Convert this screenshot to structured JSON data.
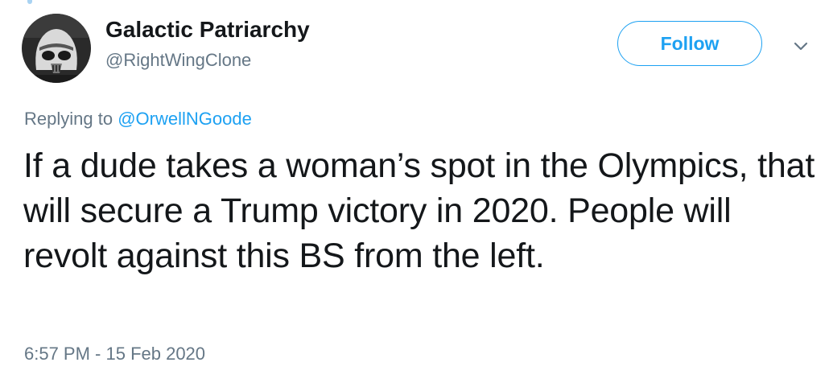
{
  "user": {
    "display_name": "Galactic Patriarchy",
    "handle": "@RightWingClone",
    "avatar_icon": "stormtrooper-helmet-avatar"
  },
  "actions": {
    "follow_label": "Follow",
    "more_icon": "chevron-down-icon"
  },
  "reply": {
    "prefix": "Replying to",
    "mention": "@OrwellNGoode"
  },
  "tweet": {
    "text": "If a dude takes a woman’s spot in the Olympics, that will secure a Trump victory in 2020. People will revolt against this BS from the left.",
    "timestamp": "6:57 PM - 15 Feb 2020"
  },
  "colors": {
    "accent": "#1da1f2",
    "text_primary": "#14171a",
    "text_secondary": "#657786"
  }
}
